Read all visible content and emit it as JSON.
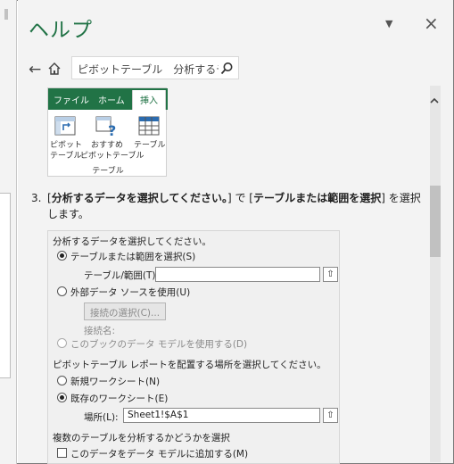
{
  "pane": {
    "title": "ヘルプ",
    "menu_icon": "caret-down-icon",
    "close_label": "×"
  },
  "nav": {
    "back_icon": "back-arrow-icon",
    "back_label": "←",
    "home_icon": "home-icon",
    "search_value": "ピボットテーブル　分析するデ",
    "search_icon": "search-icon"
  },
  "ribbon": {
    "tabs": [
      "ファイル",
      "ホーム",
      "挿入"
    ],
    "buttons": [
      {
        "line1": "ピボット",
        "line2": "テーブル",
        "icon": "pivot-table-icon"
      },
      {
        "line1": "おすすめ",
        "line2": "ピボットテーブル",
        "icon": "recommended-pivot-icon"
      },
      {
        "line1": "テーブル",
        "line2": "",
        "icon": "table-icon"
      }
    ],
    "group_label": "テーブル"
  },
  "step": {
    "number": "3.",
    "pre": "[",
    "bold1": "分析するデータを選択してください。",
    "mid": "] で [",
    "bold2": "テーブルまたは範囲を選択",
    "post": "] を選択します。"
  },
  "dialog": {
    "section1": "分析するデータを選択してください。",
    "opt_table": "テーブルまたは範囲を選択(S)",
    "table_range_label": "テーブル/範囲(T):",
    "table_range_value": "",
    "opt_external": "外部データ ソースを使用(U)",
    "choose_connection": "接続の選択(C)...",
    "connection_name": "接続名:",
    "opt_datamodel": "このブックのデータ モデルを使用する(D)",
    "section2": "ピボットテーブル レポートを配置する場所を選択してください。",
    "opt_new_sheet": "新規ワークシート(N)",
    "opt_existing_sheet": "既存のワークシート(E)",
    "location_label": "場所(L):",
    "location_value": "Sheet1!$A$1",
    "section3": "複数のテーブルを分析するかどうかを選択",
    "add_to_model": "このデータをデータ モデルに追加する(M)",
    "collapse_symbol": "⇧"
  },
  "colors": {
    "accent": "#217346",
    "pane_bg": "#f3f3f3"
  }
}
